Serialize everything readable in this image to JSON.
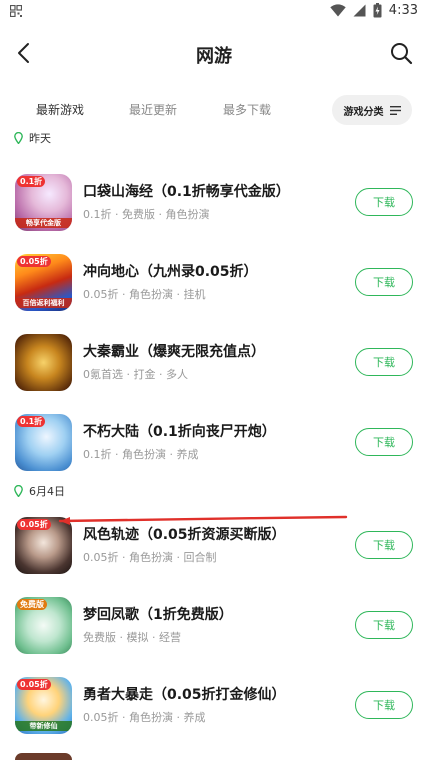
{
  "status_bar": {
    "time": "4:33"
  },
  "header": {
    "title": "网游"
  },
  "tabs": [
    {
      "label": "最新游戏",
      "active": true
    },
    {
      "label": "最近更新",
      "active": false
    },
    {
      "label": "最多下载",
      "active": false
    }
  ],
  "category_button": {
    "label": "游戏分类"
  },
  "colors": {
    "accent": "#2fb75a",
    "annotation": "#e0302a"
  },
  "sections": [
    {
      "date": "昨天",
      "games": [
        {
          "name": "口袋山海经（0.1折畅享代金版）",
          "meta": "0.1折 · 免费版 · 角色扮演",
          "download": "下载",
          "icon_tag": "0.1折",
          "icon_ribbon": "畅享代金版"
        },
        {
          "name": "冲向地心（九州录0.05折）",
          "meta": "0.05折 · 角色扮演 · 挂机",
          "download": "下载",
          "icon_tag": "0.05折",
          "icon_ribbon": "百倍返利福利"
        },
        {
          "name": "大秦霸业（爆爽无限充值点）",
          "meta": "0氪首选 · 打金 · 多人",
          "download": "下载",
          "icon_tag": "",
          "icon_ribbon": ""
        },
        {
          "name": "不朽大陆（0.1折向丧尸开炮）",
          "meta": "0.1折 · 角色扮演 · 养成",
          "download": "下载",
          "icon_tag": "0.1折",
          "icon_ribbon": ""
        }
      ]
    },
    {
      "date": "6月4日",
      "games": [
        {
          "name": "风色轨迹（0.05折资源买断版）",
          "meta": "0.05折 · 角色扮演 · 回合制",
          "download": "下载",
          "icon_tag": "0.05折",
          "icon_ribbon": ""
        },
        {
          "name": "梦回凤歌（1折免费版）",
          "meta": "免费版 · 模拟 · 经营",
          "download": "下载",
          "icon_tag": "免费版",
          "icon_ribbon": ""
        },
        {
          "name": "勇者大暴走（0.05折打金修仙）",
          "meta": "0.05折 · 角色扮演 · 养成",
          "download": "下载",
          "icon_tag": "0.05折",
          "icon_ribbon": "带新修仙"
        }
      ]
    }
  ]
}
